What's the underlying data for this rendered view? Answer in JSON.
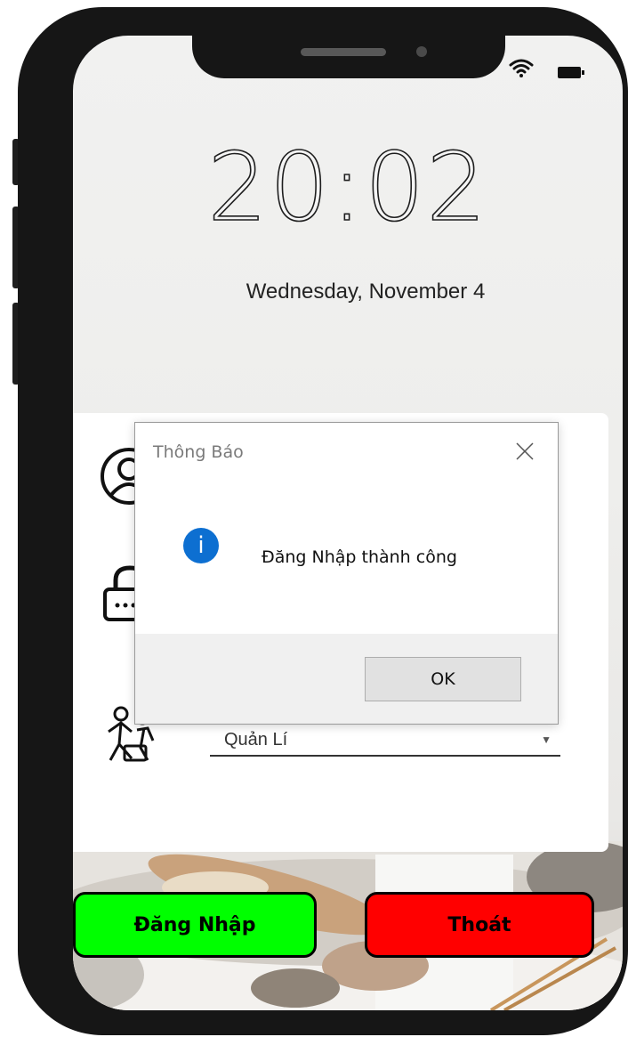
{
  "lock_screen": {
    "time": "20:02",
    "date": "Wednesday, November 4"
  },
  "login_form": {
    "role_select_value": "Quản Lí",
    "login_button": "Đăng Nhập",
    "exit_button": "Thoát",
    "colors": {
      "login": "#00ff00",
      "exit": "#ff0000"
    }
  },
  "dialog": {
    "title": "Thông Báo",
    "icon": "info-icon",
    "message": "Đăng Nhập thành công",
    "ok_button": "OK"
  }
}
